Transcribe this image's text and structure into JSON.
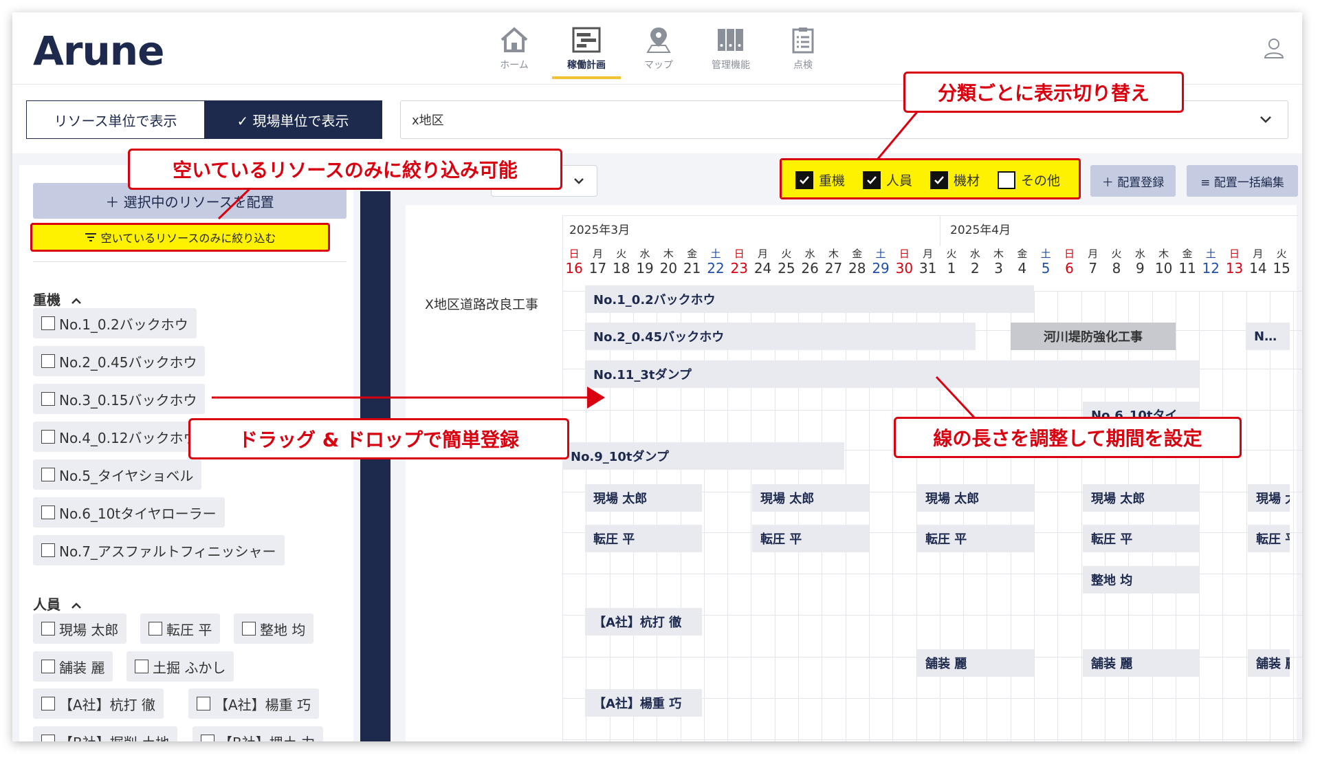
{
  "app": {
    "logo": "Arune"
  },
  "nav": [
    {
      "label": "ホーム",
      "icon": "home-icon"
    },
    {
      "label": "稼働計画",
      "icon": "gantt-icon",
      "active": true
    },
    {
      "label": "マップ",
      "icon": "map-pin-icon"
    },
    {
      "label": "管理機能",
      "icon": "binders-icon"
    },
    {
      "label": "点検",
      "icon": "clipboard-icon"
    }
  ],
  "view_toggle": {
    "resource": "リソース単位で表示",
    "site": "✓ 現場単位で表示"
  },
  "region_select": {
    "value": "x地区"
  },
  "left": {
    "assign_button": "＋ 選択中のリソースを配置",
    "filter_button": "空いているリソースのみに絞り込む",
    "heavy_section": "重機",
    "heavy": [
      "No.1_0.2バックホウ",
      "No.2_0.45バックホウ",
      "No.3_0.15バックホウ",
      "No.4_0.12バックホウ",
      "No.5_タイヤショベル",
      "No.6_10tタイヤローラー",
      "No.7_アスファルトフィニッシャー"
    ],
    "people_section": "人員",
    "people": [
      "現場 太郎",
      "転圧 平",
      "整地 均",
      "舗装 麗",
      "土掘 ふかし",
      "【A社】杭打 徹",
      "【A社】楊重 巧",
      "【B社】掘削 土地",
      "【B社】埋土 力"
    ]
  },
  "filters": {
    "heavy": "重機",
    "people": "人員",
    "equipment": "機材",
    "other": "その他"
  },
  "actions": {
    "register": "＋ 配置登録",
    "bulk_edit": "≡ 配置一括編集"
  },
  "calendar": {
    "month1": "2025年3月",
    "month2": "2025年4月",
    "days": [
      {
        "wd": "日",
        "d": "16"
      },
      {
        "wd": "月",
        "d": "17"
      },
      {
        "wd": "火",
        "d": "18"
      },
      {
        "wd": "水",
        "d": "19"
      },
      {
        "wd": "木",
        "d": "20"
      },
      {
        "wd": "金",
        "d": "21"
      },
      {
        "wd": "土",
        "d": "22"
      },
      {
        "wd": "日",
        "d": "23"
      },
      {
        "wd": "月",
        "d": "24"
      },
      {
        "wd": "火",
        "d": "25"
      },
      {
        "wd": "水",
        "d": "26"
      },
      {
        "wd": "木",
        "d": "27"
      },
      {
        "wd": "金",
        "d": "28"
      },
      {
        "wd": "土",
        "d": "29"
      },
      {
        "wd": "日",
        "d": "30"
      },
      {
        "wd": "月",
        "d": "31"
      },
      {
        "wd": "火",
        "d": "1"
      },
      {
        "wd": "水",
        "d": "2"
      },
      {
        "wd": "木",
        "d": "3"
      },
      {
        "wd": "金",
        "d": "4"
      },
      {
        "wd": "土",
        "d": "5"
      },
      {
        "wd": "日",
        "d": "6"
      },
      {
        "wd": "月",
        "d": "7"
      },
      {
        "wd": "火",
        "d": "8"
      },
      {
        "wd": "水",
        "d": "9"
      },
      {
        "wd": "木",
        "d": "10"
      },
      {
        "wd": "金",
        "d": "11"
      },
      {
        "wd": "土",
        "d": "12"
      },
      {
        "wd": "日",
        "d": "13"
      },
      {
        "wd": "月",
        "d": "14"
      },
      {
        "wd": "火",
        "d": "15"
      }
    ]
  },
  "site": "X地区道路改良工事",
  "bars": [
    {
      "label": "No.1_0.2バックホウ"
    },
    {
      "label": "No.2_0.45バックホウ"
    },
    {
      "label": "河川堤防強化工事"
    },
    {
      "label": "N…"
    },
    {
      "label": "No.11_3tダンプ"
    },
    {
      "label": "No.6_10tタイ…"
    },
    {
      "label": "No.9_10tダンプ"
    },
    {
      "label": "現場 太郎"
    },
    {
      "label": "現場 太郎"
    },
    {
      "label": "現場 太郎"
    },
    {
      "label": "現場 太郎"
    },
    {
      "label": "現場 太"
    },
    {
      "label": "転圧 平"
    },
    {
      "label": "転圧 平"
    },
    {
      "label": "転圧 平"
    },
    {
      "label": "転圧 平"
    },
    {
      "label": "転圧 平"
    },
    {
      "label": "整地 均"
    },
    {
      "label": "【A社】杭打 徹"
    },
    {
      "label": "舗装 麗"
    },
    {
      "label": "舗装 麗"
    },
    {
      "label": "舗装 麗"
    },
    {
      "label": "【A社】楊重 巧"
    }
  ],
  "callouts": {
    "category": "分類ごとに表示切り替え",
    "available": "空いているリソースのみに絞り込み可能",
    "dragdrop": "ドラッグ & ドロップで簡単登録",
    "length": "線の長さを調整して期間を設定"
  },
  "colors": {
    "navy": "#1d2a4e",
    "highlight": "#fff200",
    "callout_red": "#d9000f",
    "sunday": "#d9000f",
    "saturday": "#1f4fa8"
  }
}
